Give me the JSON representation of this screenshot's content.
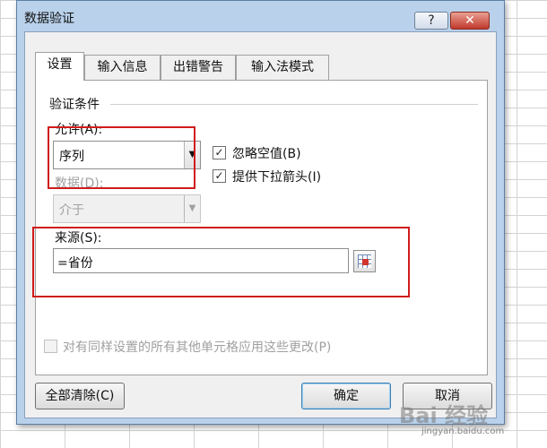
{
  "dialog": {
    "title": "数据验证",
    "help_label": "?",
    "close_label": "✕"
  },
  "tabs": [
    {
      "label": "设置",
      "active": true
    },
    {
      "label": "输入信息",
      "active": false
    },
    {
      "label": "出错警告",
      "active": false
    },
    {
      "label": "输入法模式",
      "active": false
    }
  ],
  "settings": {
    "group_label": "验证条件",
    "allow_label": "允许(A):",
    "allow_value": "序列",
    "data_label": "数据(D):",
    "data_value": "介于",
    "ignore_blank_label": "忽略空值(B)",
    "ignore_blank_checked": true,
    "dropdown_label": "提供下拉箭头(I)",
    "dropdown_checked": true,
    "source_label": "来源(S):",
    "source_value": "=省份",
    "apply_all_label": "对有同样设置的所有其他单元格应用这些更改(P)",
    "apply_all_checked": false
  },
  "buttons": {
    "clear_all": "全部清除(C)",
    "ok": "确定",
    "cancel": "取消"
  },
  "icons": {
    "dropdown_arrow": "▼",
    "checkmark": "✓"
  },
  "watermark": {
    "text": "Bai 经验",
    "url": "jingyan.baidu.com"
  },
  "colors": {
    "highlight": "#d01c1c",
    "title_bar": "#b9d1ea"
  }
}
